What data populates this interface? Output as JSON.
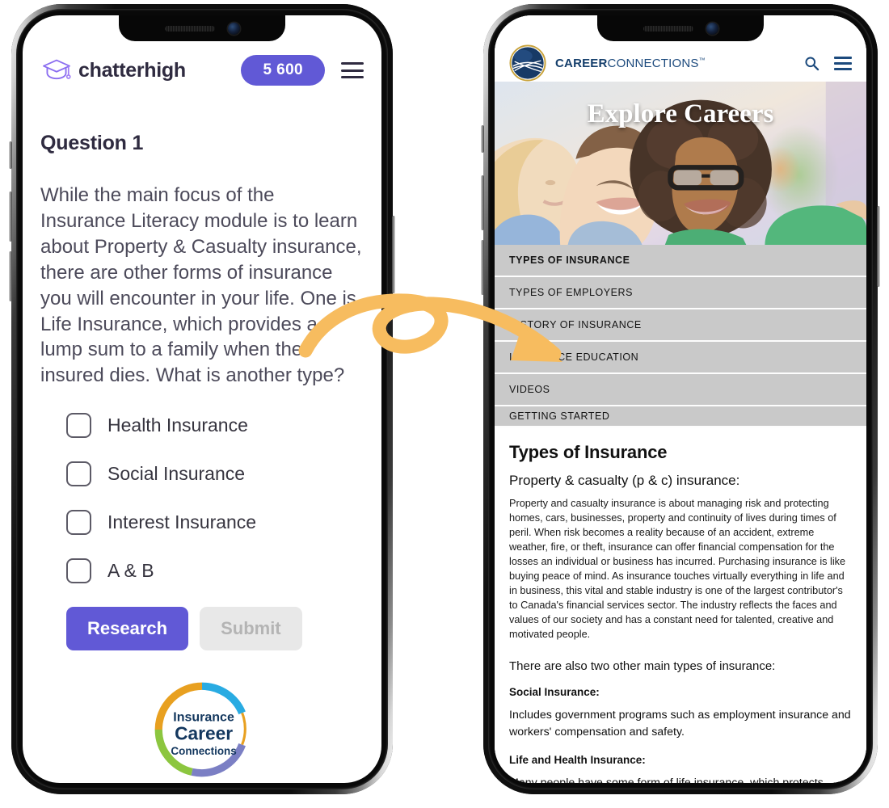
{
  "left_phone": {
    "app": "chatterhigh",
    "header": {
      "logo_icon": "graduation-cap-icon",
      "wordmark": "chatterhigh",
      "points": "5 600",
      "menu_icon": "hamburger-menu-icon",
      "accent_color": "#6159d6"
    },
    "question": {
      "title": "Question 1",
      "text": "While the main focus of the Insurance Literacy module is to learn about Property & Casualty insurance, there are other forms of insurance you will encounter in your life. One is Life Insurance, which provides a lump sum to a family when the insured dies. What is another type?"
    },
    "options": [
      {
        "label": "Health Insurance",
        "checked": false
      },
      {
        "label": "Social Insurance",
        "checked": false
      },
      {
        "label": "Interest Insurance",
        "checked": false
      },
      {
        "label": "A & B",
        "checked": false
      }
    ],
    "buttons": {
      "research": "Research",
      "submit": "Submit",
      "submit_disabled": true
    },
    "sponsor": {
      "line1": "Insurance",
      "line2": "Career",
      "line3": "Connections",
      "ring_colors": [
        "#e8a020",
        "#8cc63f",
        "#29abe2",
        "#7b7fc4"
      ]
    }
  },
  "right_phone": {
    "app": "CareerConnections",
    "header": {
      "logo_icon": "globe-logo-icon",
      "brand_bold": "CAREER",
      "brand_light": "CONNECTIONS",
      "trademark": "™",
      "search_icon": "search-icon",
      "menu_icon": "hamburger-menu-icon",
      "accent_color": "#1c4a7d"
    },
    "hero": {
      "title": "Explore Careers",
      "image_alt": "three smiling young people outdoors"
    },
    "nav_items": [
      {
        "label": "TYPES OF INSURANCE",
        "active": true
      },
      {
        "label": "TYPES OF EMPLOYERS",
        "active": false
      },
      {
        "label": "HISTORY OF INSURANCE",
        "active": false
      },
      {
        "label": "INSURANCE EDUCATION",
        "active": false
      },
      {
        "label": "VIDEOS",
        "active": false
      },
      {
        "label": "GETTING STARTED",
        "active": false
      }
    ],
    "content": {
      "heading": "Types of Insurance",
      "subheading": "Property & casualty (p & c) insurance:",
      "paragraph": "Property and casualty insurance is about managing risk and protecting homes, cars, businesses, property and continuity of lives during times of peril. When risk becomes a reality because of an accident, extreme weather, fire, or theft, insurance can offer financial compensation for the losses an individual or business has incurred. Purchasing insurance is like buying peace of mind. As insurance touches virtually everything in life and in business, this vital and stable industry is one of the largest contributor's to Canada's financial services sector. The industry reflects the faces and values of our society and has a constant need for talented, creative and motivated people.",
      "lead_in": "There are also two other main types of insurance:",
      "social_heading": "Social Insurance:",
      "social_text": "Includes government programs such as employment insurance and workers' compensation and safety.",
      "life_heading": "Life and Health Insurance:",
      "life_text": "Many people have some form of life insurance, which protects"
    }
  },
  "annotation": {
    "type": "curved-looping-arrow",
    "color": "#F7BC5F",
    "direction": "left-phone-to-right-phone"
  }
}
